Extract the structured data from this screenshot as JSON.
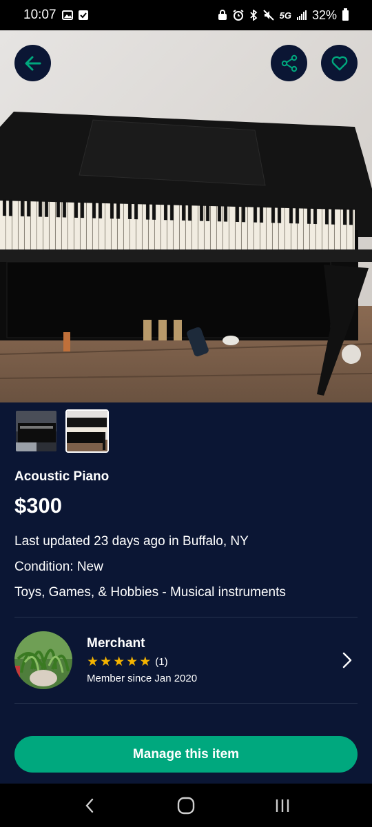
{
  "status_bar": {
    "time": "10:07",
    "network": "5G",
    "battery": "32%"
  },
  "listing": {
    "title": "Acoustic Piano",
    "price": "$300",
    "updated": "Last updated 23 days ago in Buffalo, NY",
    "condition": "Condition: New",
    "category": "Toys, Games, & Hobbies - Musical instruments",
    "thumbnails": [
      "thumbnail-1",
      "thumbnail-2"
    ]
  },
  "merchant": {
    "name": "Merchant",
    "rating": 5,
    "rating_count": "(1)",
    "member_since": "Member since Jan 2020"
  },
  "actions": {
    "manage": "Manage this item"
  },
  "icons": {
    "back": "arrow-left-icon",
    "share": "share-icon",
    "favorite": "heart-icon",
    "chevron": "chevron-right-icon"
  },
  "colors": {
    "background": "#0b1634",
    "accent": "#00a87e",
    "star": "#f5b400"
  }
}
